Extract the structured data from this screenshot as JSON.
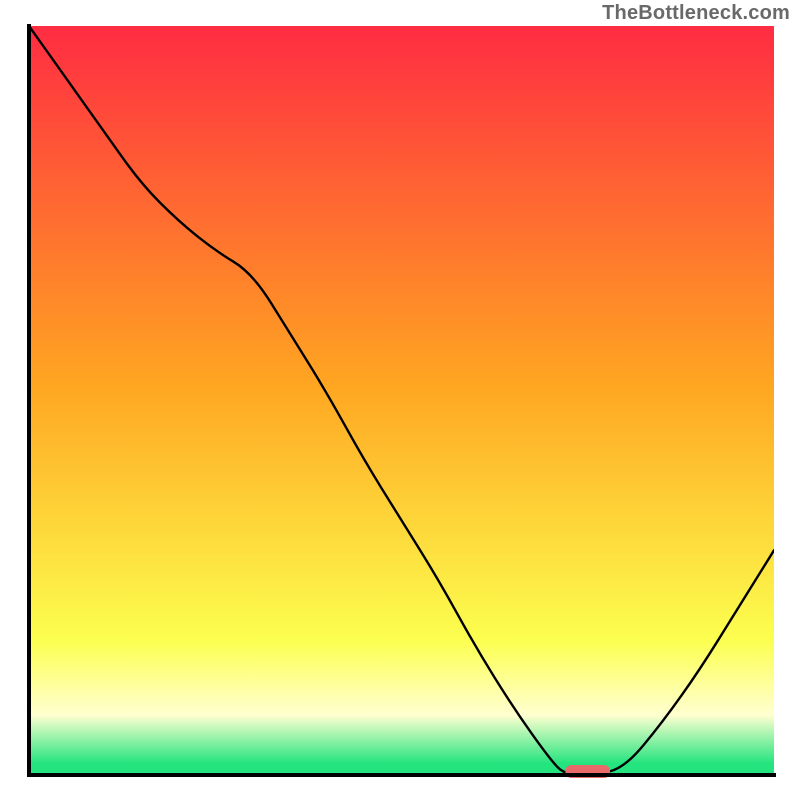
{
  "watermark": "TheBottleneck.com",
  "colors": {
    "red": "#ff2c42",
    "orange": "#ffa621",
    "yellow": "#fcff4f",
    "paleYellow": "#ffffd0",
    "green": "#23e47e",
    "curve": "#000000",
    "marker": "#e96a6a",
    "axis": "#000000"
  },
  "plot": {
    "inner_x": 29,
    "inner_y": 26,
    "inner_w": 745,
    "inner_h": 749,
    "axis_stroke": 4
  },
  "chart_data": {
    "type": "line",
    "title": "",
    "xlabel": "",
    "ylabel": "",
    "xlim": [
      0,
      100
    ],
    "ylim": [
      0,
      100
    ],
    "series": [
      {
        "name": "bottleneck-curve",
        "x": [
          0,
          5,
          10,
          15,
          20,
          25,
          30,
          35,
          40,
          45,
          50,
          55,
          60,
          65,
          70,
          72,
          76,
          80,
          85,
          90,
          95,
          100
        ],
        "y": [
          100,
          93,
          86,
          79,
          74,
          70,
          67,
          59,
          51,
          42,
          34,
          26,
          17,
          9,
          2,
          0,
          0,
          1,
          7,
          14,
          22,
          30
        ]
      }
    ],
    "marker": {
      "name": "optimum-marker",
      "x_start": 72,
      "x_end": 78,
      "y": 0
    },
    "gradient_stops_y_pct": [
      {
        "pct": 0,
        "meaning": "top-red"
      },
      {
        "pct": 48,
        "meaning": "orange"
      },
      {
        "pct": 82,
        "meaning": "yellow"
      },
      {
        "pct": 92,
        "meaning": "pale-yellow"
      },
      {
        "pct": 98.5,
        "meaning": "green"
      },
      {
        "pct": 100,
        "meaning": "bottom-green"
      }
    ]
  }
}
